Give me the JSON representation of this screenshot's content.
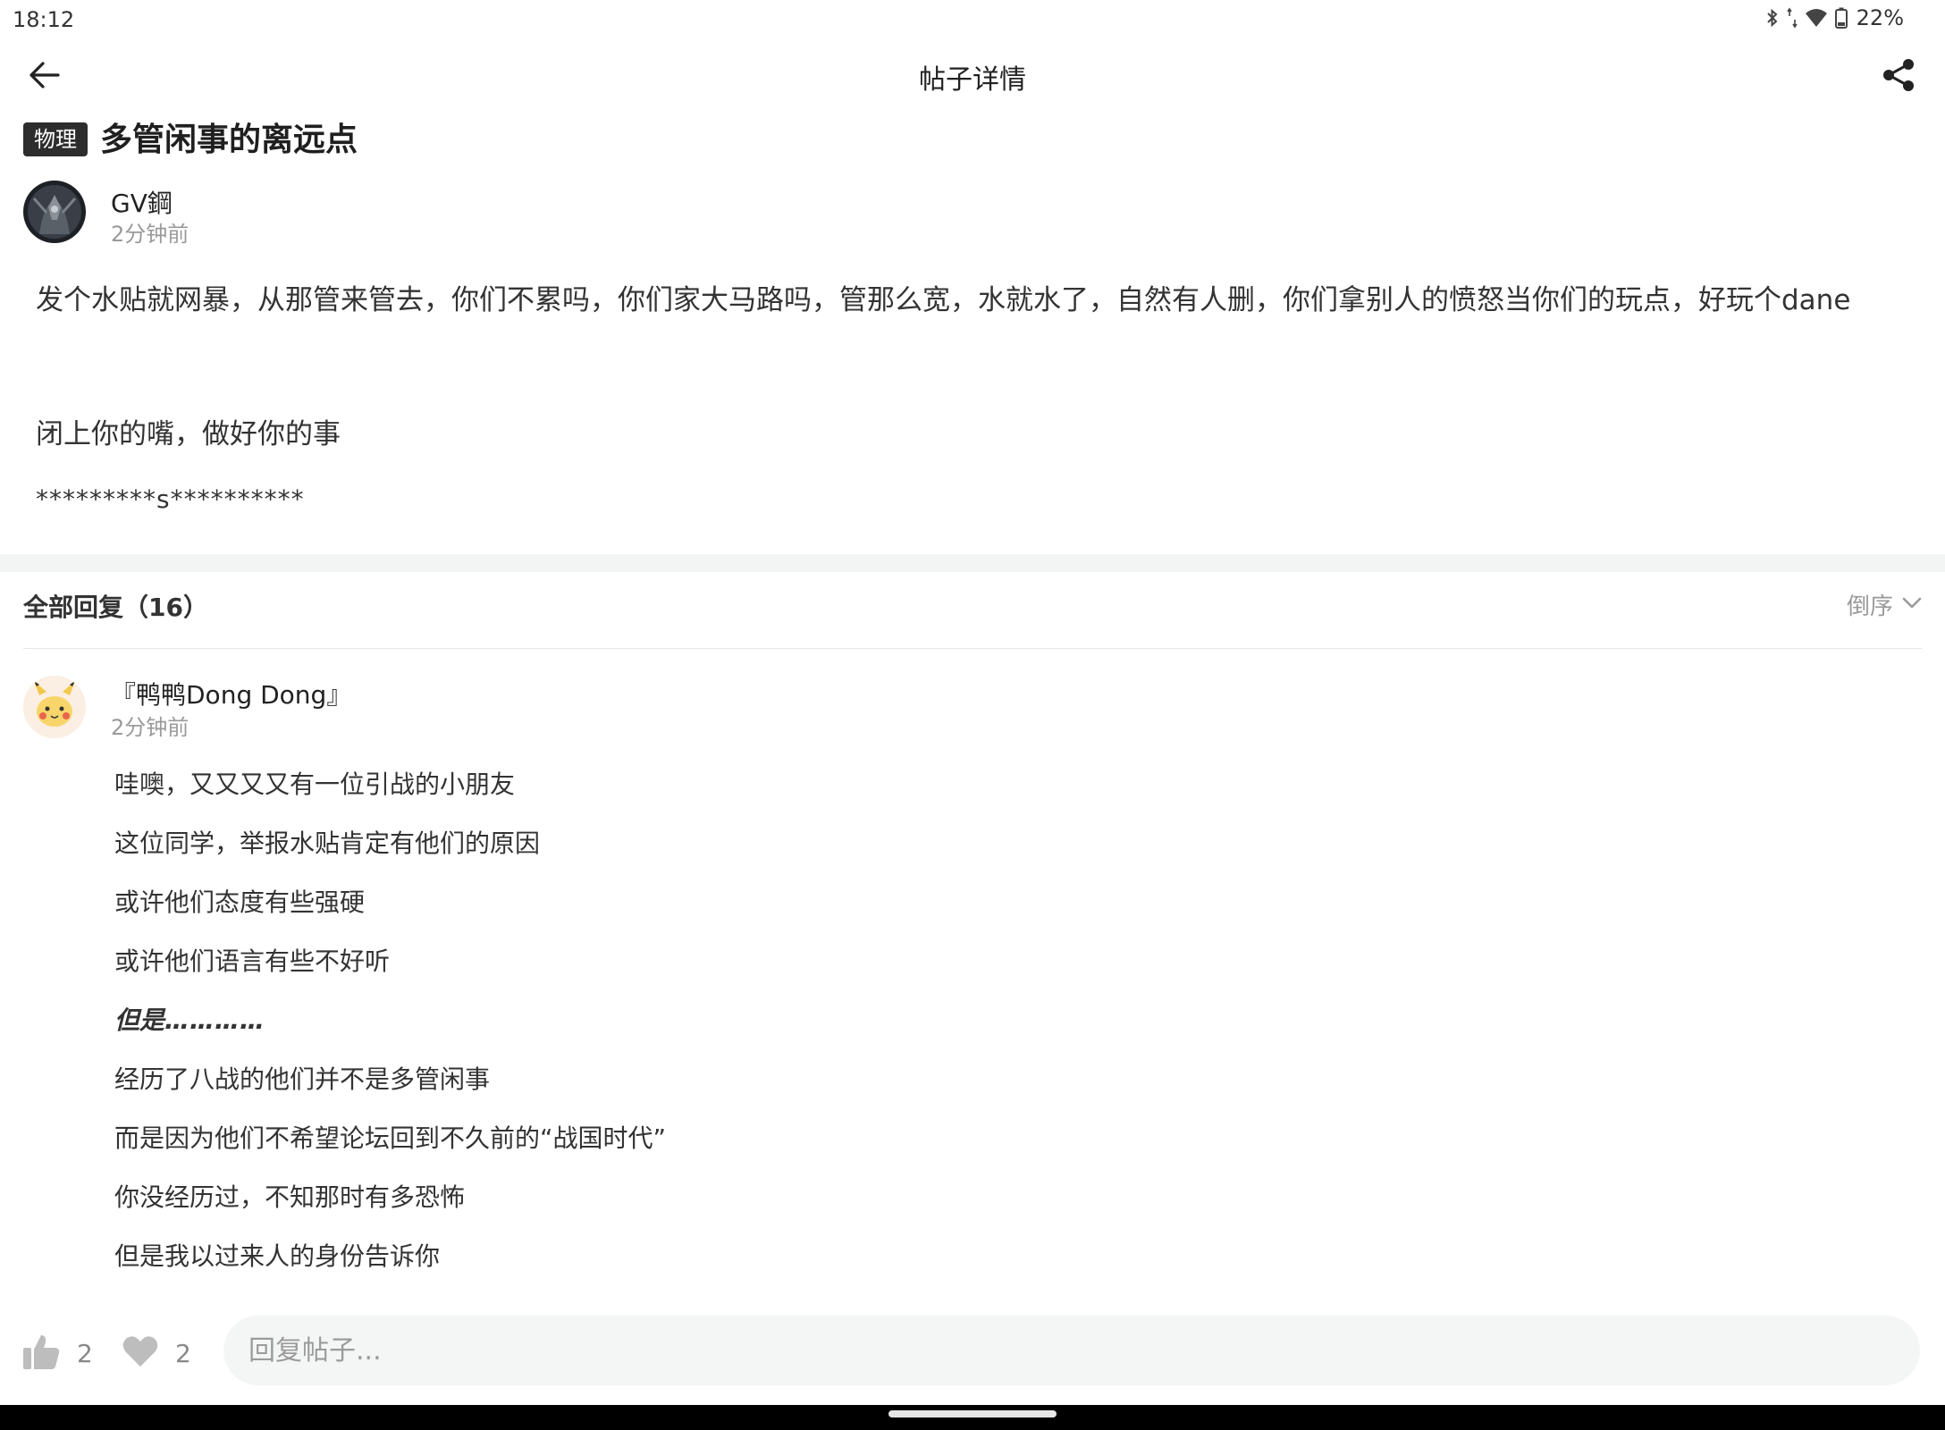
{
  "status_bar": {
    "time": "18:12",
    "battery": "22%"
  },
  "header": {
    "title": "帖子详情",
    "back_icon": "arrow-left-icon",
    "share_icon": "share-icon"
  },
  "post": {
    "category": "物理",
    "title": "多管闲事的离远点",
    "author": "GV鋼",
    "time": "2分钟前",
    "body": [
      "发个水贴就网暴，从那管来管去，你们不累吗，你们家大马路吗，管那么宽，水就水了，自然有人删，你们拿别人的愤怒当你们的玩点，好玩个dane",
      "闭上你的嘴，做好你的事",
      "*********s**********"
    ]
  },
  "replies": {
    "title": "全部回复（16）",
    "sort_label": "倒序",
    "items": [
      {
        "author": "『鸭鸭Dong Dong』",
        "time": "2分钟前",
        "lines": [
          "哇噢，又又又又有一位引战的小朋友",
          "这位同学，举报水贴肯定有他们的原因",
          "或许他们态度有些强硬",
          "或许他们语言有些不好听",
          "但是…………",
          "经历了八战的他们并不是多管闲事",
          "而是因为他们不希望论坛回到不久前的“战国时代”",
          "你没经历过，不知那时有多恐怖",
          "但是我以过来人的身份告诉你"
        ]
      }
    ]
  },
  "bottom_bar": {
    "like_count": "2",
    "favorite_count": "2",
    "reply_placeholder": "回复帖子..."
  },
  "colors": {
    "tag_bg": "#2d2d2d",
    "muted": "#9a9a9a",
    "band": "#f3f4f4"
  }
}
